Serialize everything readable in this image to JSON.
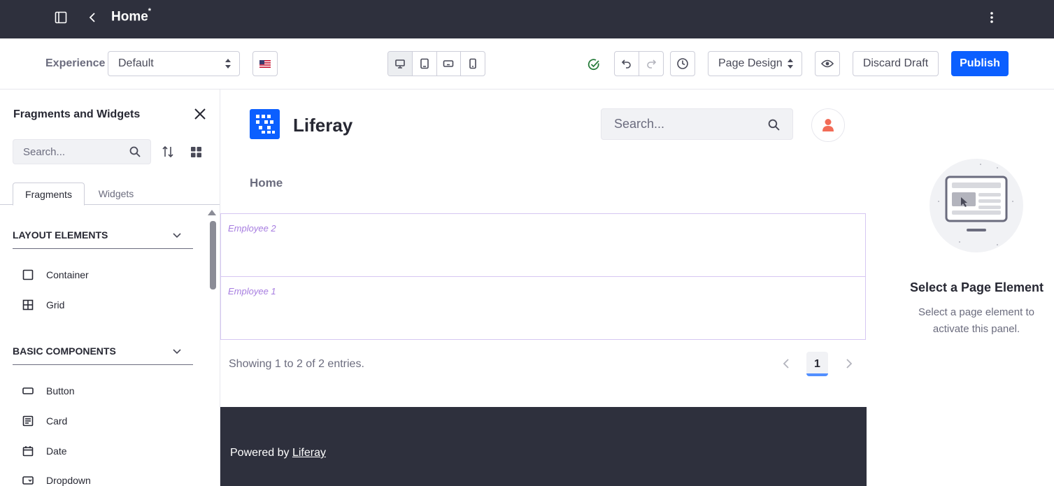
{
  "topbar": {
    "title": "Home",
    "modified_marker": "*"
  },
  "toolbar": {
    "experience_label": "Experience",
    "experience_value": "Default",
    "language_flag": "flag-us-icon",
    "page_mode": "Page Design",
    "discard_label": "Discard Draft",
    "publish_label": "Publish"
  },
  "sidebar": {
    "title": "Fragments and Widgets",
    "search_placeholder": "Search...",
    "tabs": [
      "Fragments",
      "Widgets"
    ],
    "sections": [
      {
        "title": "LAYOUT ELEMENTS",
        "items": [
          "Container",
          "Grid"
        ]
      },
      {
        "title": "BASIC COMPONENTS",
        "items": [
          "Button",
          "Card",
          "Date",
          "Dropdown"
        ]
      }
    ]
  },
  "canvas": {
    "brand": "Liferay",
    "search_placeholder": "Search...",
    "nav_home": "Home",
    "entries": [
      "Employee 2",
      "Employee 1"
    ],
    "showing": "Showing 1 to 2 of 2 entries.",
    "current_page": "1",
    "footer_powered": "Powered by",
    "footer_link": "Liferay"
  },
  "right_panel": {
    "title": "Select a Page Element",
    "description": "Select a page element to activate this panel."
  },
  "colors": {
    "topbar_bg": "#2e303d",
    "primary": "#0b5fff",
    "entry_border": "#d6c7f2",
    "entry_label": "#a77de0",
    "success": "#287d3c"
  }
}
